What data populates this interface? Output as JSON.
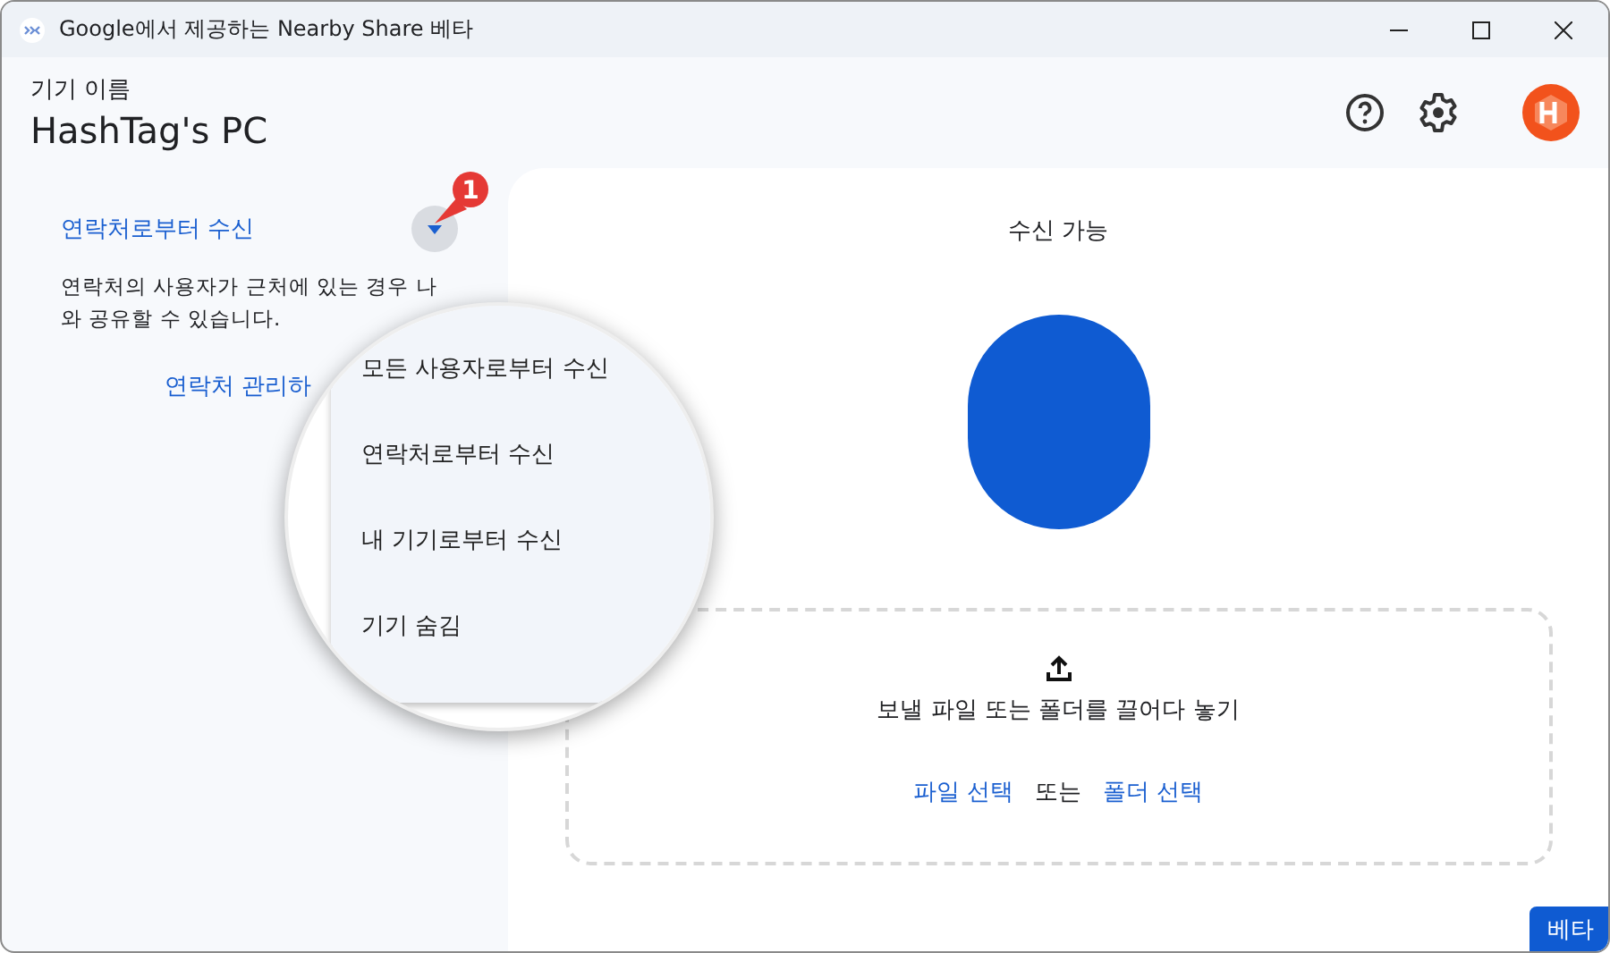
{
  "window": {
    "title": "Google에서 제공하는 Nearby Share 베타"
  },
  "header": {
    "label": "기기 이름",
    "device_name": "HashTag's PC"
  },
  "sidebar": {
    "visibility": "연락처로부터 수신",
    "description": "연락처의 사용자가 근처에 있는 경우 나와 공유할 수 있습니다.",
    "manage_link": "연락처 관리하"
  },
  "annotation": {
    "number": "1"
  },
  "menu": {
    "items": [
      {
        "label": "모든 사용자로부터 수신"
      },
      {
        "label": "연락처로부터 수신"
      },
      {
        "label": "내 기기로부터 수신"
      },
      {
        "label": "기기 숨김"
      }
    ]
  },
  "main": {
    "status": "수신 가능",
    "drop_text": "보낼 파일 또는 폴더를 끌어다 놓기",
    "file_link": "파일 선택",
    "or_text": "또는",
    "folder_link": "폴더 선택"
  },
  "badge": "베타"
}
